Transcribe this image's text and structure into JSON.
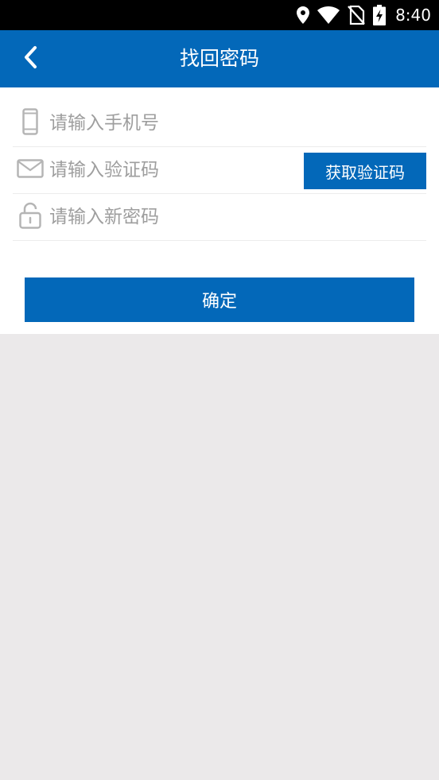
{
  "status_bar": {
    "time": "8:40",
    "icons": [
      "location-icon",
      "wifi-icon",
      "no-sim-icon",
      "battery-charging-icon"
    ]
  },
  "header": {
    "back_icon": "chevron-left-icon",
    "title": "找回密码"
  },
  "form": {
    "phone": {
      "icon": "phone-icon",
      "placeholder": "请输入手机号",
      "value": ""
    },
    "code": {
      "icon": "mail-icon",
      "placeholder": "请输入验证码",
      "value": "",
      "button_label": "获取验证码"
    },
    "password": {
      "icon": "lock-icon",
      "placeholder": "请输入新密码",
      "value": ""
    },
    "confirm_label": "确定"
  },
  "colors": {
    "primary": "#0368b9",
    "background": "#ebe9ea",
    "placeholder": "#9e9e9e",
    "icon": "#b5b5b5"
  }
}
